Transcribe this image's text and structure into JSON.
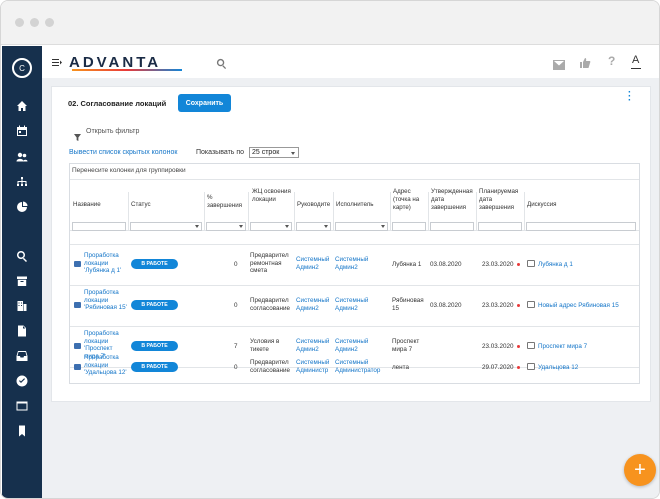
{
  "app": {
    "logo": "ADVANTA",
    "avatar": "C",
    "topbar_avatar": "A"
  },
  "page": {
    "title": "02. Согласование локаций",
    "save_label": "Сохранить",
    "filter_label": "Открыть фильтр",
    "hidden_columns_link": "Вывести список скрытых колонок",
    "show_by_label": "Показывать по",
    "rows_select": "25 строк",
    "group_hint": "Перенесите колонки для группировки"
  },
  "table": {
    "headers": [
      "Название",
      "Статус",
      "% завершения",
      "ЖЦ освоения локации",
      "Руководите",
      "Исполнитель",
      "Адрес (точка на карте)",
      "Утвержденная дата завершения",
      "Планируемая дата завершения",
      "Дискуссия"
    ],
    "rows": [
      {
        "name": "Проработка локации 'Лубянка д 1'",
        "status": "В РАБОТЕ",
        "percent": "0",
        "lifecycle": "Предварител ремонтная смета",
        "manager": "Системный Админ2",
        "executor": "Системный Админ2",
        "address": "Лубянка 1",
        "approved": "03.08.2020",
        "planned": "23.03.2020",
        "discussion": "Лубянка д 1"
      },
      {
        "name": "Проработка локации 'Рябиновая 15'",
        "status": "В РАБОТЕ",
        "percent": "0",
        "lifecycle": "Предварител согласование",
        "manager": "Системный Админ2",
        "executor": "Системный Админ2",
        "address": "Рябиновая 15",
        "approved": "03.08.2020",
        "planned": "23.03.2020",
        "discussion": "Новый адрес Рябиновая 15"
      },
      {
        "name": "Проработка локации 'Проспект мира 7'",
        "status": "В РАБОТЕ",
        "percent": "7",
        "lifecycle": "Условия в тикете",
        "manager": "Системный Админ2",
        "executor": "Системный Админ2",
        "address": "Проспект мира 7",
        "approved": "",
        "planned": "23.03.2020",
        "discussion": "Проспект мира 7"
      },
      {
        "name": "Проработка локации 'Удальцова 12'",
        "status": "В РАБОТЕ",
        "percent": "0",
        "lifecycle": "Предварител согласование",
        "manager": "Системный Администр",
        "executor": "Системный Администратор",
        "address": "лента",
        "approved": "",
        "planned": "29.07.2020",
        "discussion": "Удальцова 12"
      }
    ]
  },
  "colors": {
    "sidebar": "#16304d",
    "accent": "#1286d8",
    "fab": "#f7931e",
    "overdue": "#e83a3a"
  },
  "icons": {
    "sidebar": [
      "home-icon",
      "calendar-icon",
      "users-icon",
      "org-chart-icon",
      "pie-chart-icon",
      "search-icon",
      "archive-icon",
      "building-icon",
      "document-icon",
      "inbox-icon",
      "check-circle-icon",
      "window-icon",
      "bookmark-icon"
    ],
    "topbar": [
      "menu-icon",
      "search-icon",
      "mail-icon",
      "thumbs-up-icon",
      "help-icon",
      "user-icon"
    ],
    "fab": "+"
  }
}
